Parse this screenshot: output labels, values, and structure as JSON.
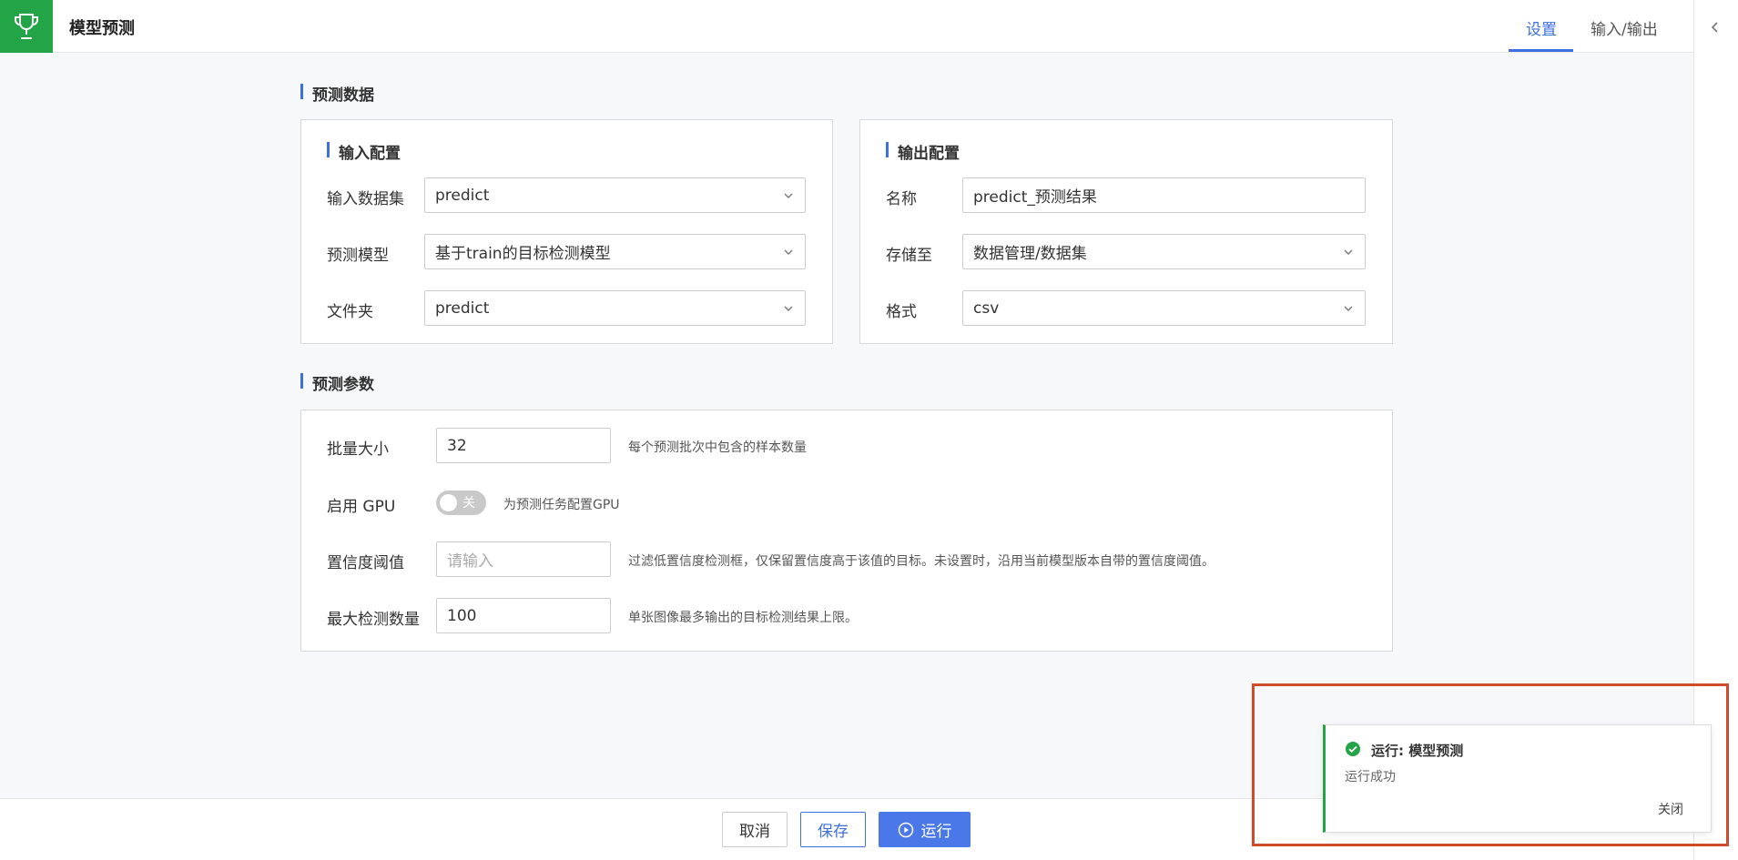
{
  "header": {
    "title": "模型预测",
    "tabs": [
      {
        "label": "设置",
        "active": true
      },
      {
        "label": "输入/输出",
        "active": false
      }
    ]
  },
  "sections": {
    "predict_data_title": "预测数据",
    "predict_params_title": "预测参数"
  },
  "input_config": {
    "title": "输入配置",
    "dataset_label": "输入数据集",
    "dataset_value": "predict",
    "model_label": "预测模型",
    "model_value": "基于train的目标检测模型",
    "folder_label": "文件夹",
    "folder_value": "predict"
  },
  "output_config": {
    "title": "输出配置",
    "name_label": "名称",
    "name_value": "predict_预测结果",
    "storage_label": "存储至",
    "storage_value": "数据管理/数据集",
    "format_label": "格式",
    "format_value": "csv"
  },
  "params": {
    "batch_label": "批量大小",
    "batch_value": "32",
    "batch_hint": "每个预测批次中包含的样本数量",
    "gpu_label": "启用 GPU",
    "gpu_toggle_text": "关",
    "gpu_enabled": false,
    "gpu_hint": "为预测任务配置GPU",
    "conf_label": "置信度阈值",
    "conf_placeholder": "请输入",
    "conf_hint": "过滤低置信度检测框，仅保留置信度高于该值的目标。未设置时，沿用当前模型版本自带的置信度阈值。",
    "maxdet_label": "最大检测数量",
    "maxdet_value": "100",
    "maxdet_hint": "单张图像最多输出的目标检测结果上限。"
  },
  "footer": {
    "cancel_label": "取消",
    "save_label": "保存",
    "run_label": "运行"
  },
  "toast": {
    "title": "运行: 模型预测",
    "message": "运行成功",
    "close_label": "关闭"
  },
  "colors": {
    "accent": "#3d6fe0",
    "brand_green": "#22a447",
    "highlight_red": "#d04a2e"
  }
}
